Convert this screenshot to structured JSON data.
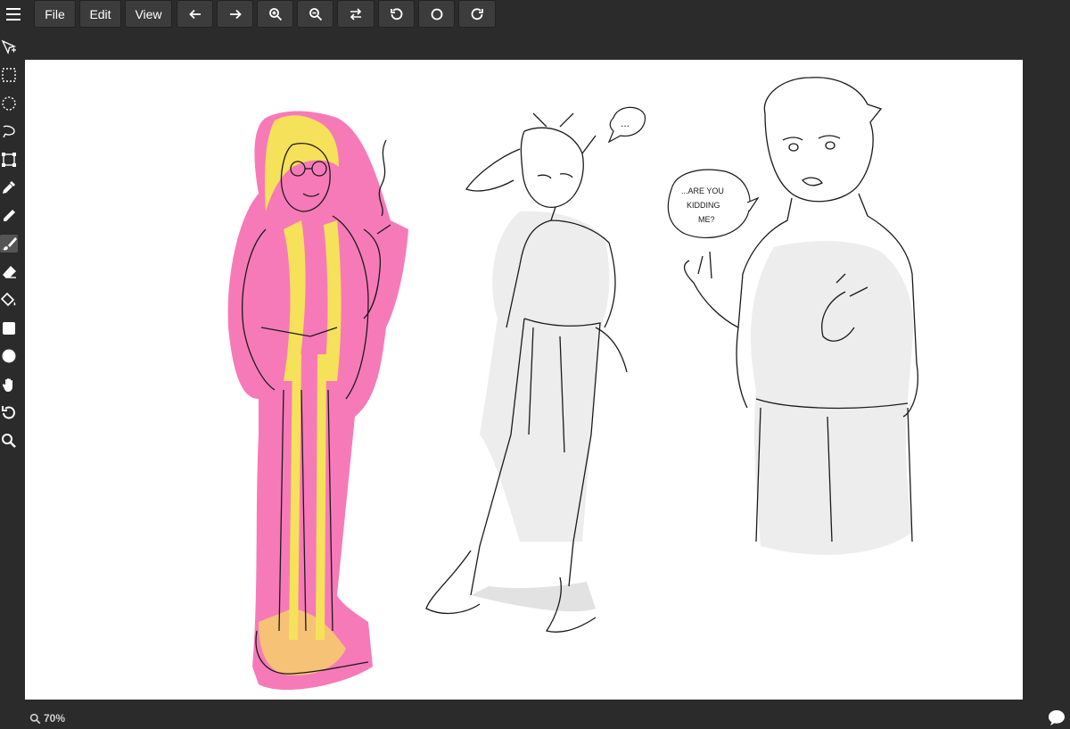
{
  "toolbar": {
    "menu_icon": "hamburger-icon",
    "file_label": "File",
    "edit_label": "Edit",
    "view_label": "View",
    "icons": [
      "arrow-left-icon",
      "arrow-right-icon",
      "zoom-in-icon",
      "zoom-out-icon",
      "swap-icon",
      "rotate-left-icon",
      "reset-rotation-icon",
      "rotate-right-icon"
    ]
  },
  "tools": [
    "move-icon",
    "rect-select-icon",
    "ellipse-select-icon",
    "lasso-icon",
    "transform-icon",
    "eyedropper-icon",
    "pencil-icon",
    "brush-icon",
    "eraser-icon",
    "fill-bucket-icon",
    "rectangle-icon",
    "ellipse-icon",
    "hand-icon",
    "undo-icon",
    "zoom-icon"
  ],
  "active_tool": "brush-icon",
  "canvas": {
    "speech_bubble_1": "...",
    "speech_bubble_2_lines": [
      "...ARE YOU",
      "KIDDING",
      "ME?"
    ],
    "colors": {
      "pink": "#f77ab8",
      "yellow": "#f5e15a",
      "gray": "#e8e8e8",
      "ink": "#1a1a1a"
    }
  },
  "status": {
    "zoom": "70%",
    "chat_icon": "speech-bubble-icon"
  }
}
